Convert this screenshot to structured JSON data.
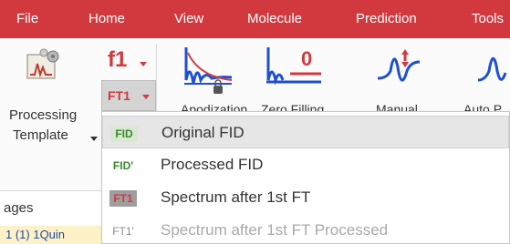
{
  "menubar": {
    "items": [
      {
        "label": "File"
      },
      {
        "label": "Home"
      },
      {
        "label": "View"
      },
      {
        "label": "Molecule"
      },
      {
        "label": "Prediction"
      },
      {
        "label": "Tools"
      }
    ]
  },
  "ribbon": {
    "processing_template": {
      "line1": "Processing",
      "line2": "Template"
    },
    "f1_label": "f1",
    "ft1_label": "FT1",
    "tools": [
      {
        "label": "Apodization"
      },
      {
        "label": "Zero Filling"
      },
      {
        "label": "Manual"
      },
      {
        "label": "Auto P"
      }
    ]
  },
  "left_panel": {
    "pages_label": "ages",
    "doc_row": "1  (1) 1Quin"
  },
  "dropdown": {
    "items": [
      {
        "icon": "FID",
        "label": "Original FID",
        "highlighted": true,
        "disabled": false
      },
      {
        "icon": "FID'",
        "label": "Processed FID",
        "highlighted": false,
        "disabled": false
      },
      {
        "icon": "FT1",
        "label": "Spectrum after 1st FT",
        "highlighted": false,
        "disabled": false
      },
      {
        "icon": "FT1'",
        "label": "Spectrum after 1st FT Processed",
        "highlighted": false,
        "disabled": true
      }
    ]
  },
  "colors": {
    "menubar": "#d2393f",
    "accent": "#d2393f",
    "fid_green": "#3a8a2e",
    "spectrum_blue": "#1f4fd0"
  },
  "icons": [
    "processing-template-icon",
    "apodization-icon",
    "zero-filling-icon",
    "manual-phase-icon",
    "auto-phase-icon"
  ]
}
